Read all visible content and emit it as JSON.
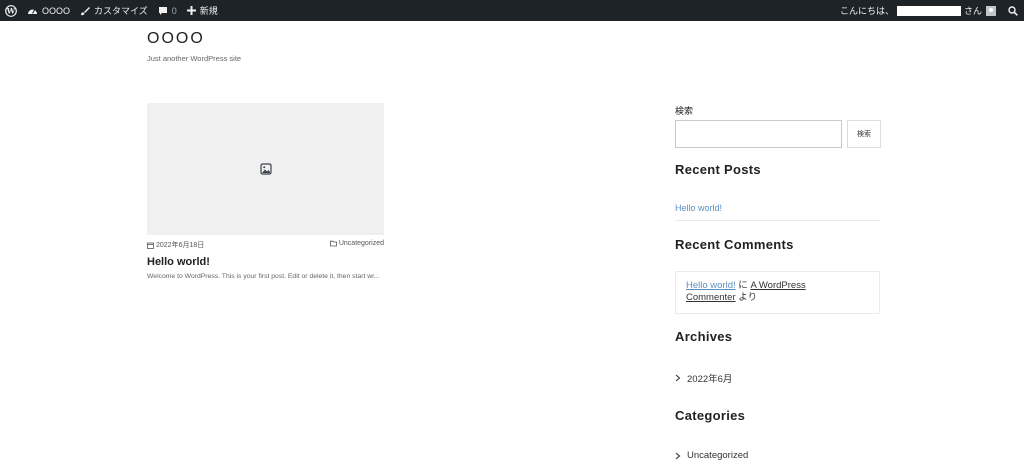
{
  "admin_bar": {
    "site_name": "OOOO",
    "customize": "カスタマイズ",
    "comments_count": "0",
    "new": "新規",
    "greeting": "こんにちは、",
    "san": "さん"
  },
  "header": {
    "title": "OOOO",
    "description": "Just another WordPress site"
  },
  "post": {
    "date": "2022年6月18日",
    "category": "Uncategorized",
    "title": "Hello world!",
    "excerpt": "Welcome to WordPress. This is your first post. Edit or delete it, then start wr..."
  },
  "sidebar": {
    "search_label": "検索",
    "search_value": "",
    "search_button": "検索",
    "recent_posts_title": "Recent Posts",
    "recent_posts": [
      "Hello world!"
    ],
    "recent_comments_title": "Recent Comments",
    "comment": {
      "post_link": "Hello world!",
      "ni": "に",
      "author_line1": "A WordPress",
      "author_line2": "Commenter",
      "yori": "より"
    },
    "archives_title": "Archives",
    "archives": [
      "2022年6月"
    ],
    "categories_title": "Categories",
    "categories": [
      "Uncategorized"
    ]
  },
  "colors": {
    "admin_bar_bg": "#1d2327",
    "link": "#5a8fc4"
  }
}
